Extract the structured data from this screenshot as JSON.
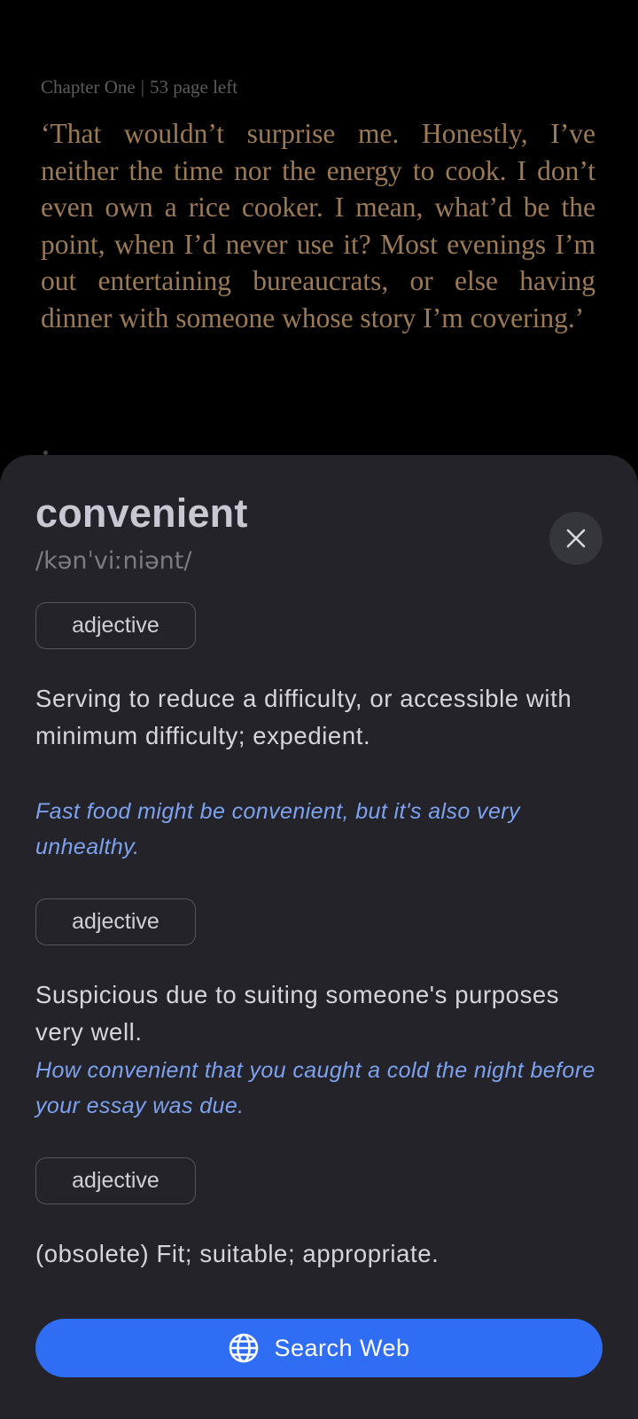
{
  "reader": {
    "chapter": "Chapter One",
    "separator": "|",
    "pages_left": "53 page left",
    "passage": "‘That wouldn’t surprise me. Honestly, I’ve neither the time nor the energy to cook. I don’t even own a rice cooker. I mean, what’d be the point, when I’d never use it? Most evenings I’m out entertaining bureaucrats, or else having dinner with someone whose story I’m covering.’"
  },
  "dictionary": {
    "word": "convenient",
    "phonetic": "/kənˈviːniənt/",
    "close_icon": "close-icon",
    "senses": [
      {
        "pos": "adjective",
        "definition": "Serving to reduce a difficulty, or accessible with minimum difficulty; expedient.",
        "example": "Fast food might be convenient, but it's also very unhealthy."
      },
      {
        "pos": "adjective",
        "definition": "Suspicious due to suiting someone's purposes very well.",
        "example": "How convenient that you caught a cold the night before your essay was due."
      },
      {
        "pos": "adjective",
        "definition": "(obsolete) Fit; suitable; appropriate."
      }
    ],
    "search_button": {
      "label": "Search Web",
      "icon": "globe-icon"
    }
  },
  "colors": {
    "background": "#000000",
    "passage_text": "#9c7a55",
    "sheet": "#232329",
    "example_text": "#7da2ef",
    "accent": "#2f6df5"
  }
}
